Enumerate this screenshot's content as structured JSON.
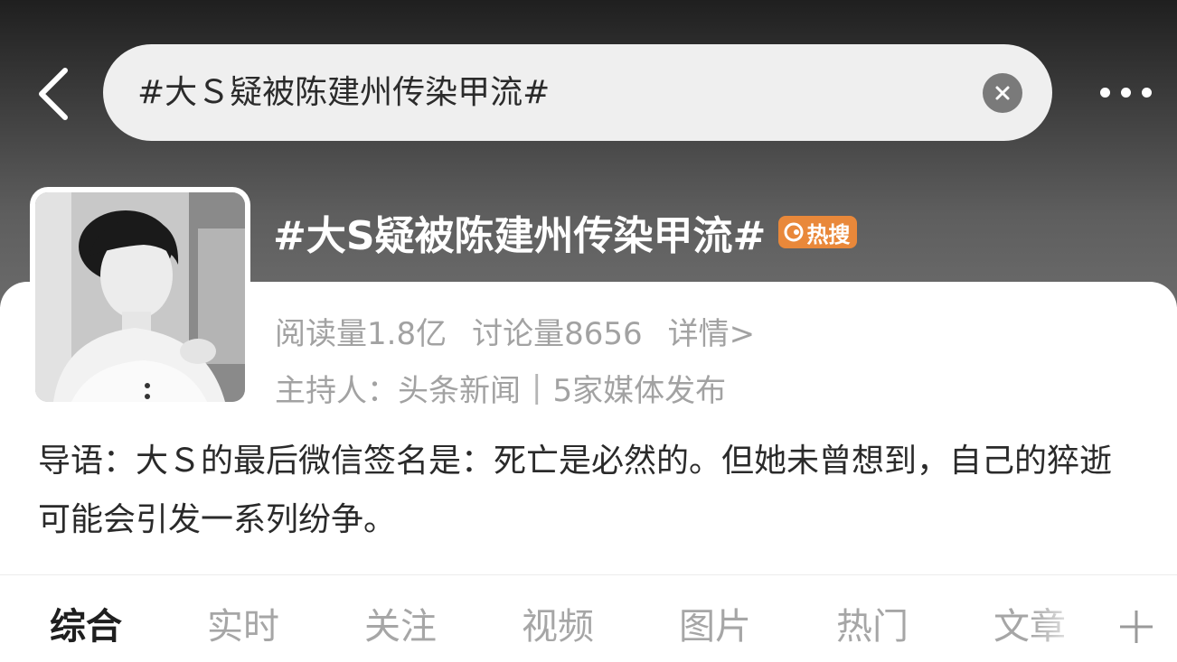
{
  "search": {
    "query": "#大Ｓ疑被陈建州传染甲流#"
  },
  "topic": {
    "title": "#大S疑被陈建州传染甲流#",
    "hot_badge": "热搜",
    "reads": "阅读量1.8亿",
    "discussions": "讨论量8656",
    "details_link": "详情>",
    "host_label": "主持人：",
    "host_name": "头条新闻",
    "separator": "|",
    "media_count": "5家媒体发布",
    "intro": "导语：大Ｓ的最后微信签名是：死亡是必然的。但她未曾想到，自己的猝逝可能会引发一系列纷争。"
  },
  "tabs": [
    {
      "label": "综合",
      "active": true
    },
    {
      "label": "实时"
    },
    {
      "label": "关注"
    },
    {
      "label": "视频"
    },
    {
      "label": "图片"
    },
    {
      "label": "热门"
    },
    {
      "label": "文章"
    }
  ],
  "icons": {
    "back": "chevron-left-icon",
    "clear": "close-circle-icon",
    "more": "more-horizontal-icon",
    "add": "plus-icon",
    "hot": "fire-icon"
  },
  "colors": {
    "hot_badge": "#e9883a",
    "meta_text": "#a2a2a2",
    "inactive_tab": "#a6a6a6",
    "active_tab": "#1f1f1f"
  }
}
